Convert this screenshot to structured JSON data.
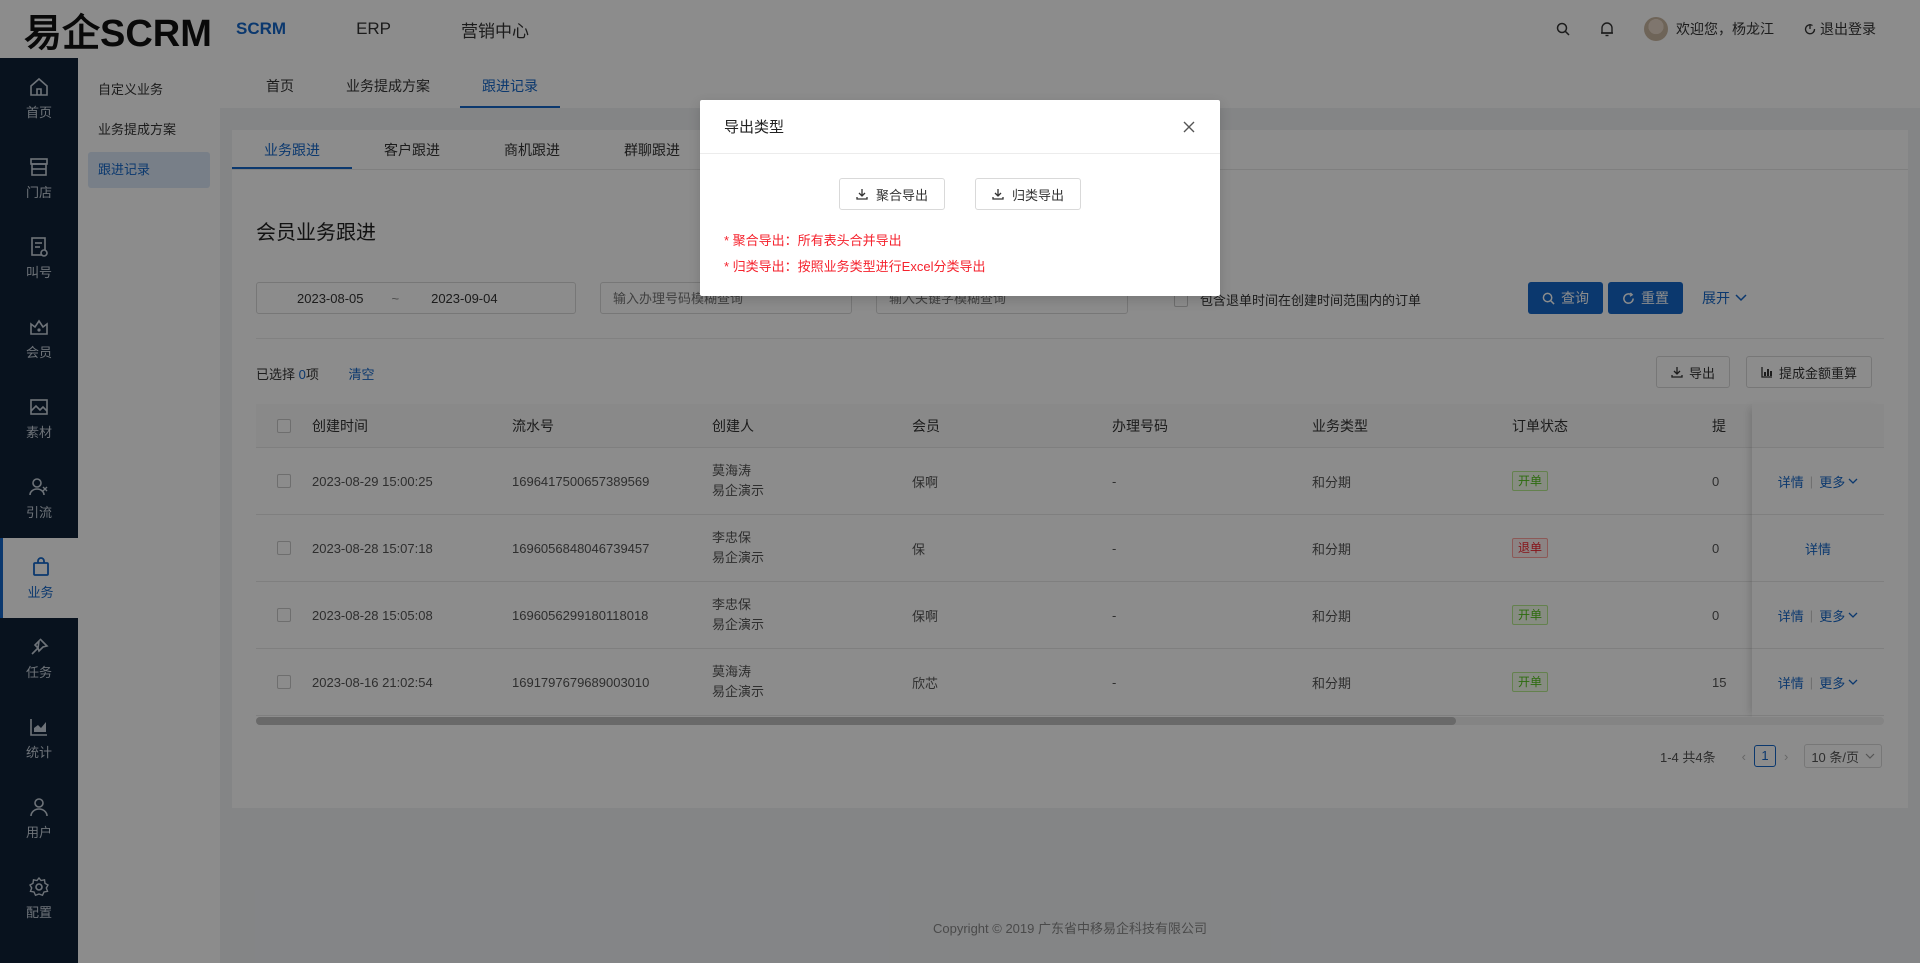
{
  "header": {
    "logo": "易企SCRM",
    "nav": [
      "SCRM",
      "ERP",
      "营销中心"
    ],
    "welcome": "欢迎您，杨龙江",
    "logout": "退出登录"
  },
  "rail": {
    "items": [
      {
        "label": "首页",
        "icon": "home-icon"
      },
      {
        "label": "门店",
        "icon": "store-icon"
      },
      {
        "label": "叫号",
        "icon": "queue-icon"
      },
      {
        "label": "会员",
        "icon": "crown-icon"
      },
      {
        "label": "素材",
        "icon": "image-icon"
      },
      {
        "label": "引流",
        "icon": "people-icon"
      },
      {
        "label": "业务",
        "icon": "bag-icon"
      },
      {
        "label": "任务",
        "icon": "pin-icon"
      },
      {
        "label": "统计",
        "icon": "chart-icon"
      },
      {
        "label": "用户",
        "icon": "user-icon"
      },
      {
        "label": "配置",
        "icon": "gear-icon"
      }
    ]
  },
  "submenu": {
    "items": [
      "自定义业务",
      "业务提成方案",
      "跟进记录"
    ]
  },
  "page_tabs": [
    "首页",
    "业务提成方案",
    "跟进记录"
  ],
  "sub_tabs": [
    "业务跟进",
    "客户跟进",
    "商机跟进",
    "群聊跟进"
  ],
  "card_title": "会员业务跟进",
  "filters": {
    "date_start": "2023-08-05",
    "date_sep": "~",
    "date_end": "2023-09-04",
    "number_placeholder": "输入办理号码模糊查询",
    "keyword_placeholder": "输入关键字模糊查询",
    "refund_check_label": "包含退单时间在创建时间范围内的订单",
    "query": "查询",
    "reset": "重置",
    "expand": "展开"
  },
  "selection": {
    "prefix": "已选择 ",
    "count": "0",
    "suffix": "项",
    "clear": "清空"
  },
  "actions": {
    "export": "导出",
    "recalc": "提成金额重算"
  },
  "table": {
    "headers": [
      "创建时间",
      "流水号",
      "创建人",
      "会员",
      "办理号码",
      "业务类型",
      "订单状态",
      "提"
    ],
    "rows": [
      {
        "time": "2023-08-29 15:00:25",
        "serial": "1696417500657389569",
        "creator": "莫海涛",
        "creator_org": "易企演示",
        "member": "保啊",
        "number": "-",
        "type": "和分期",
        "status": "开单",
        "amount": "0",
        "detail": "详情",
        "more": "更多"
      },
      {
        "time": "2023-08-28 15:07:18",
        "serial": "1696056848046739457",
        "creator": "李忠保",
        "creator_org": "易企演示",
        "member": "保",
        "number": "-",
        "type": "和分期",
        "status": "退单",
        "amount": "0",
        "detail": "详情",
        "more": ""
      },
      {
        "time": "2023-08-28 15:05:08",
        "serial": "1696056299180118018",
        "creator": "李忠保",
        "creator_org": "易企演示",
        "member": "保啊",
        "number": "-",
        "type": "和分期",
        "status": "开单",
        "amount": "0",
        "detail": "详情",
        "more": "更多"
      },
      {
        "time": "2023-08-16 21:02:54",
        "serial": "1691797679689003010",
        "creator": "莫海涛",
        "creator_org": "易企演示",
        "member": "欣芯",
        "number": "-",
        "type": "和分期",
        "status": "开单",
        "amount": "15",
        "detail": "详情",
        "more": "更多"
      }
    ]
  },
  "pagination": {
    "total": "1-4 共4条",
    "current": "1",
    "size": "10 条/页"
  },
  "copyright": "Copyright © 2019 广东省中移易企科技有限公司",
  "modal": {
    "title": "导出类型",
    "btn_merge": "聚合导出",
    "btn_classify": "归类导出",
    "note1": "* 聚合导出：所有表头合并导出",
    "note2": "* 归类导出：按照业务类型进行Excel分类导出"
  },
  "colors": {
    "primary": "#1467c9",
    "rail_bg": "#0f2237",
    "danger": "#f5222d",
    "success": "#52c41a"
  }
}
